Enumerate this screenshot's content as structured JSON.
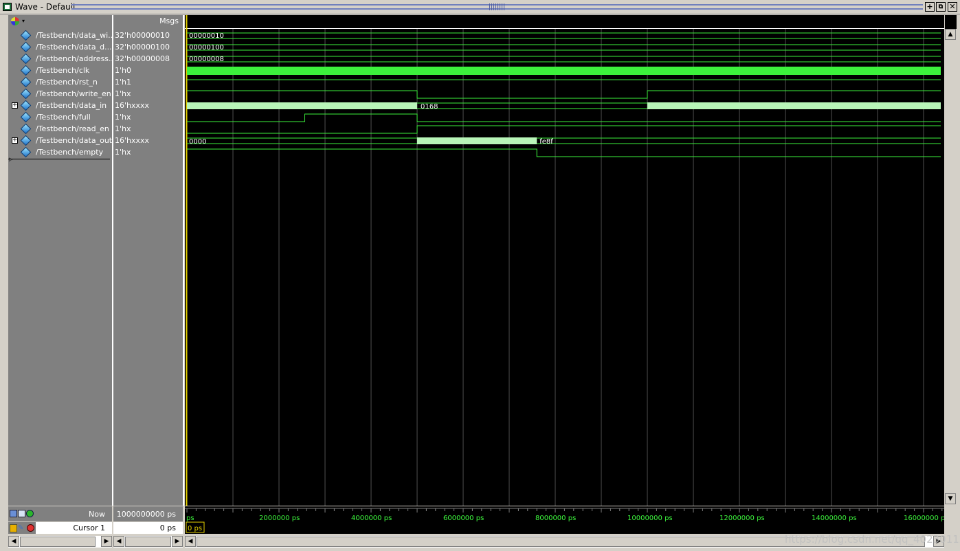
{
  "window": {
    "title": "Wave - Default",
    "controls": [
      "+",
      "⧉",
      "✕"
    ]
  },
  "header": {
    "names_icon": "signal-group-icon",
    "msgs_label": "Msgs"
  },
  "signals": [
    {
      "name": "/Testbench/data_wi...",
      "value": "32'h00000010",
      "expandable": false
    },
    {
      "name": "/Testbench/data_d...",
      "value": "32'h00000100",
      "expandable": false
    },
    {
      "name": "/Testbench/address...",
      "value": "32'h00000008",
      "expandable": false
    },
    {
      "name": "/Testbench/clk",
      "value": "1'h0",
      "expandable": false
    },
    {
      "name": "/Testbench/rst_n",
      "value": "1'h1",
      "expandable": false
    },
    {
      "name": "/Testbench/write_en",
      "value": "1'hx",
      "expandable": false
    },
    {
      "name": "/Testbench/data_in",
      "value": "16'hxxxx",
      "expandable": true
    },
    {
      "name": "/Testbench/full",
      "value": "1'hx",
      "expandable": false
    },
    {
      "name": "/Testbench/read_en",
      "value": "1'hx",
      "expandable": false
    },
    {
      "name": "/Testbench/data_out",
      "value": "16'hxxxx",
      "expandable": true
    },
    {
      "name": "/Testbench/empty",
      "value": "1'hx",
      "expandable": false
    }
  ],
  "wave_labels": {
    "data_wi": "00000010",
    "data_d": "00000100",
    "address": "00000008",
    "data_in": "0168",
    "data_out_a": "0000",
    "data_out_b": "fe8f"
  },
  "footer": {
    "now_label": "Now",
    "now_value": "1000000000 ps",
    "cursor_label": "Cursor 1",
    "cursor_value": "0 ps",
    "cursor_marker": "0 ps"
  },
  "timeline": {
    "unit": "ps",
    "range_ps": [
      0,
      16400000
    ],
    "ticks": [
      {
        "t": 0,
        "label": "ps"
      },
      {
        "t": 2000000,
        "label": "2000000 ps"
      },
      {
        "t": 4000000,
        "label": "4000000 ps"
      },
      {
        "t": 6000000,
        "label": "6000000 ps"
      },
      {
        "t": 8000000,
        "label": "8000000 ps"
      },
      {
        "t": 10000000,
        "label": "10000000 ps"
      },
      {
        "t": 12000000,
        "label": "12000000 ps"
      },
      {
        "t": 14000000,
        "label": "14000000 ps"
      },
      {
        "t": 16000000,
        "label": "16000000 p"
      }
    ]
  },
  "colors": {
    "wave": "#3cf23c",
    "bus_fill": "#b8f5b8",
    "cursor": "#e6d200",
    "background": "#000000",
    "grid": "#505050"
  },
  "watermark": "https://blog.csdn.net/qq_40230112"
}
